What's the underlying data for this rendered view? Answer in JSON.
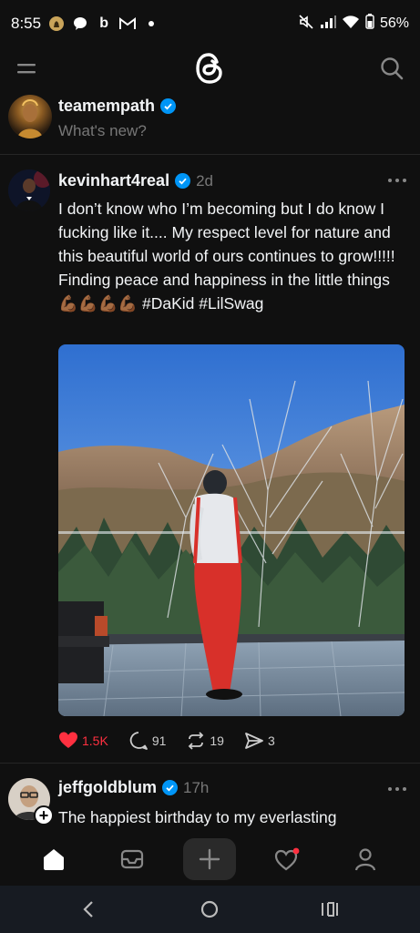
{
  "status_bar": {
    "time": "8:55",
    "battery": "56%",
    "icons_left": [
      "chess-knight-icon",
      "chat-bubble-icon",
      "b-icon",
      "gmail-icon",
      "dot-icon"
    ],
    "icons_right": [
      "mute-icon",
      "signal-icon",
      "wifi-icon",
      "battery-icon"
    ]
  },
  "composer": {
    "username": "teamempath",
    "placeholder": "What's new?"
  },
  "post": {
    "username": "kevinhart4real",
    "time": "2d",
    "text": "I don’t know who I’m becoming but I do know I fucking like it.... My respect level for nature and this beautiful world of ours continues to grow!!!!! Finding peace and happiness in the little things 💪🏾💪🏾💪🏾💪🏾 #DaKid #LilSwag",
    "likes": "1.5K",
    "comments": "91",
    "reposts": "19",
    "shares": "3"
  },
  "post2": {
    "username": "jeffgoldblum",
    "time": "17h",
    "text": "The happiest birthday to my everlasting"
  },
  "bottom_nav": {
    "items": [
      "home-icon",
      "inbox-icon",
      "create-icon",
      "activity-icon",
      "profile-icon"
    ]
  },
  "colors": {
    "background": "#101010",
    "verified": "#0095f6",
    "like": "#ff3040",
    "muted": "#777777"
  }
}
